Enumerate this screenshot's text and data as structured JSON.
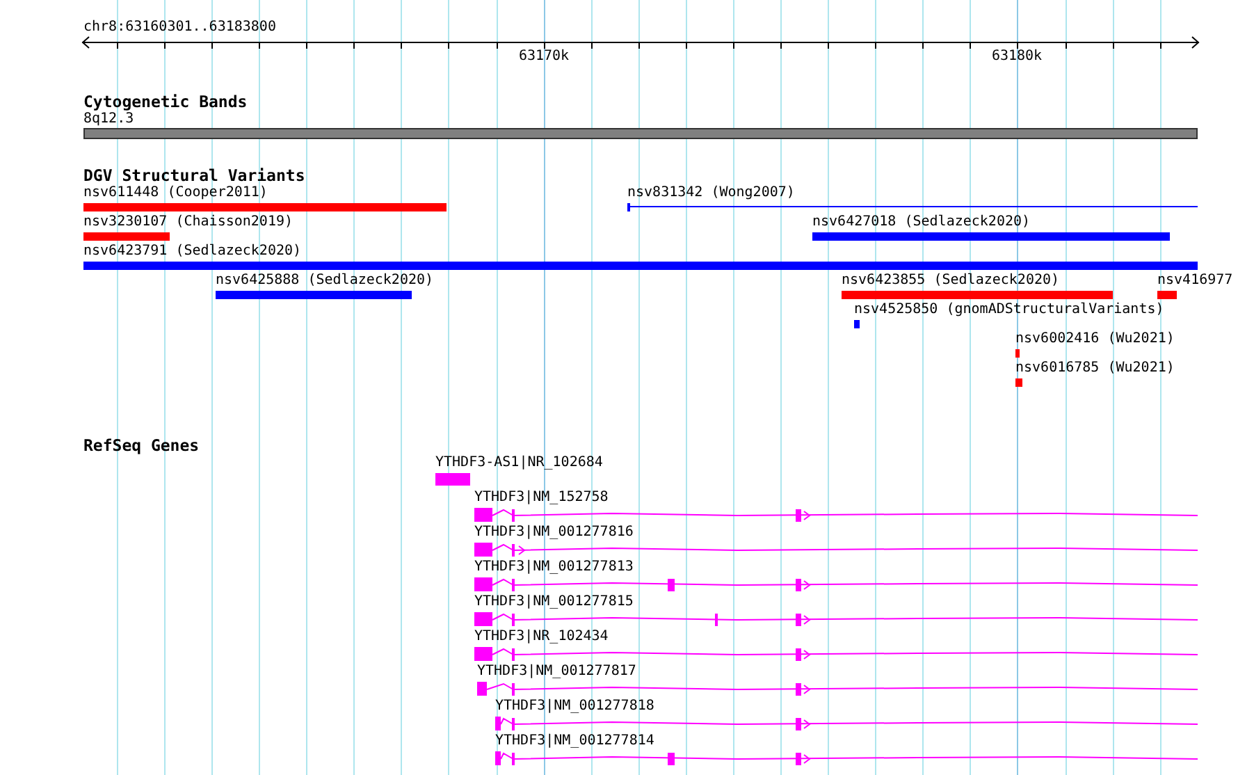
{
  "ruler": {
    "range": "chr8:63160301..63183800",
    "tick_labels": [
      "63170k",
      "63180k"
    ]
  },
  "tracks": [
    {
      "kind": "cytoband",
      "title": "Cytogenetic Bands",
      "features": [
        {
          "kind": "band",
          "label": "8q12.3"
        }
      ]
    },
    {
      "kind": "variants",
      "title": "DGV Structural Variants",
      "features": [
        {
          "kind": "bar",
          "label": "nsv611448 (Cooper2011)",
          "color": "#ff0000"
        },
        {
          "kind": "line",
          "label": "nsv831342 (Wong2007)",
          "color": "#0000ff"
        },
        {
          "kind": "bar",
          "label": "nsv3230107 (Chaisson2019)",
          "color": "#ff0000"
        },
        {
          "kind": "bar",
          "label": "nsv6427018 (Sedlazeck2020)",
          "color": "#0000ff"
        },
        {
          "kind": "bar",
          "label": "nsv6423791 (Sedlazeck2020)",
          "color": "#0000ff"
        },
        {
          "kind": "bar",
          "label": "nsv6425888 (Sedlazeck2020)",
          "color": "#0000ff"
        },
        {
          "kind": "bar",
          "label": "nsv6423855 (Sedlazeck2020)",
          "color": "#ff0000"
        },
        {
          "kind": "bar",
          "label": "nsv416977",
          "color": "#ff0000"
        },
        {
          "kind": "bar",
          "label": "nsv4525850 (gnomADStructuralVariants)",
          "color": "#0000ff"
        },
        {
          "kind": "bar",
          "label": "nsv6002416 (Wu2021)",
          "color": "#ff0000"
        },
        {
          "kind": "bar",
          "label": "nsv6016785 (Wu2021)",
          "color": "#ff0000"
        }
      ]
    },
    {
      "kind": "genes",
      "title": "RefSeq Genes",
      "features": [
        {
          "kind": "noncoding",
          "label": "YTHDF3-AS1|NR_102684"
        },
        {
          "kind": "transcript",
          "label": "YTHDF3|NM_152758"
        },
        {
          "kind": "transcript",
          "label": "YTHDF3|NM_001277816"
        },
        {
          "kind": "transcript",
          "label": "YTHDF3|NM_001277813"
        },
        {
          "kind": "transcript",
          "label": "YTHDF3|NM_001277815"
        },
        {
          "kind": "transcript",
          "label": "YTHDF3|NR_102434"
        },
        {
          "kind": "transcript",
          "label": "YTHDF3|NM_001277817"
        },
        {
          "kind": "transcript",
          "label": "YTHDF3|NM_001277818"
        },
        {
          "kind": "transcript",
          "label": "YTHDF3|NM_001277814"
        }
      ]
    }
  ]
}
